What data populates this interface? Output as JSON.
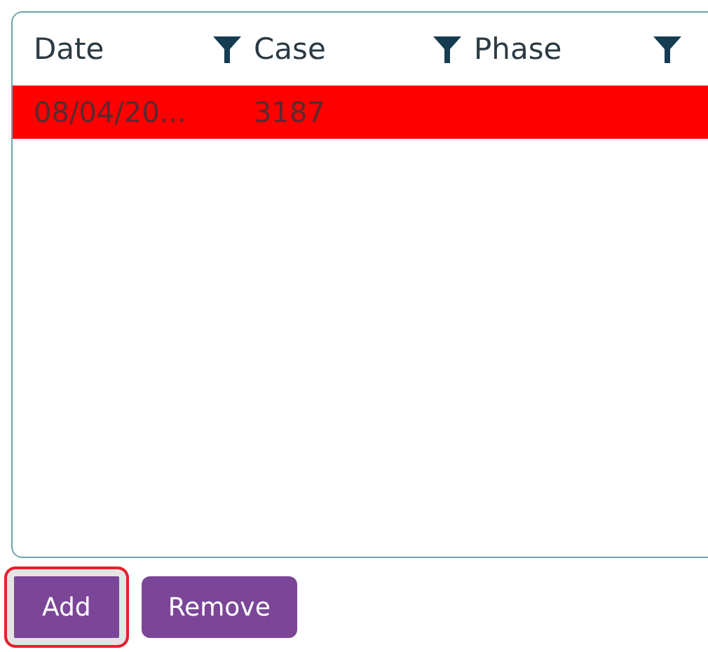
{
  "table": {
    "columns": [
      {
        "label": "Date"
      },
      {
        "label": "Case"
      },
      {
        "label": "Phase"
      }
    ],
    "rows": [
      {
        "cells": [
          "08/04/20...",
          "3187"
        ],
        "highlighted": true
      }
    ]
  },
  "buttons": [
    {
      "label": "Add",
      "focused": true
    },
    {
      "label": "Remove",
      "focused": false
    }
  ]
}
